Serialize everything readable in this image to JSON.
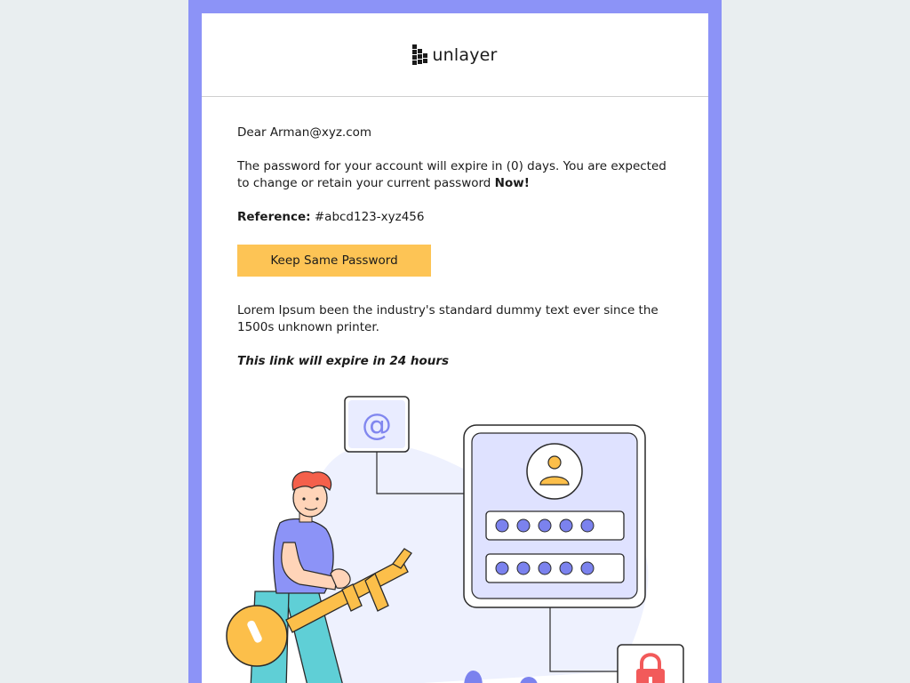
{
  "brand": {
    "name": "unlayer"
  },
  "email": {
    "greeting": "Dear Arman@xyz.com",
    "expiry_text": "The password for your account will expire in (0) days. You are expected to change or retain your current password ",
    "expiry_emphasis": "Now!",
    "reference_label": "Reference:",
    "reference_value": " #abcd123-xyz456",
    "button_label": "Keep Same Password",
    "body_text": "Lorem Ipsum been the industry's standard dummy text ever since the 1500s unknown printer.",
    "link_expiry": "This link will expire in 24 hours"
  },
  "illustration": {
    "at_symbol": "@",
    "icons": [
      "at-sign-icon",
      "user-avatar-icon",
      "padlock-icon",
      "key-icon"
    ]
  },
  "colors": {
    "frame": "#8c93f7",
    "button": "#fdc455",
    "background": "#e9eef0",
    "accent_blue": "#7b82ee",
    "key_yellow": "#fcbf4a"
  }
}
